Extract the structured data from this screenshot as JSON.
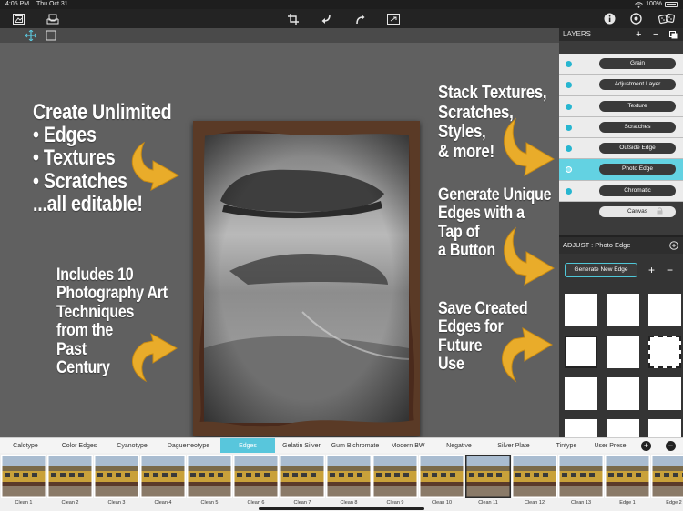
{
  "status": {
    "time": "4:05 PM",
    "date": "Thu Oct 31",
    "battery": "100%"
  },
  "toolbar": {
    "left_icons": [
      "gallery-icon",
      "save-tray-icon"
    ],
    "center_icons": [
      "crop-icon",
      "undo-icon",
      "redo-icon",
      "fit-screen-icon"
    ],
    "right_icons": [
      "info-icon",
      "settings-icon",
      "dice-icon"
    ]
  },
  "promo": {
    "left_top": [
      "Create Unlimited",
      "• Edges",
      "• Textures",
      "• Scratches",
      "...all editable!"
    ],
    "left_bottom": [
      "Includes 10",
      "Photography Art",
      "Techniques",
      "from the",
      "Past",
      "Century"
    ],
    "right_1": [
      "Stack Textures,",
      "Scratches,",
      "Styles,",
      "& more!"
    ],
    "right_2": [
      "Generate Unique",
      "Edges with a",
      "Tap of",
      "a Button"
    ],
    "right_3": [
      "Save Created",
      "Edges for",
      "Future",
      "Use"
    ]
  },
  "layers": {
    "title": "LAYERS",
    "add": "+",
    "remove": "−",
    "items": [
      {
        "label": "Grain",
        "selected": false
      },
      {
        "label": "Adjustment Layer",
        "selected": false
      },
      {
        "label": "Texture",
        "selected": false
      },
      {
        "label": "Scratches",
        "selected": false
      },
      {
        "label": "Outside Edge",
        "selected": false
      },
      {
        "label": "Photo Edge",
        "selected": true
      },
      {
        "label": "Chromatic",
        "selected": false
      }
    ],
    "canvas_label": "Canvas"
  },
  "adjust": {
    "title": "ADJUST : Photo Edge",
    "generate_label": "Generate New Edge",
    "add": "+",
    "remove": "−"
  },
  "tabs": {
    "items": [
      "Calotype",
      "Color Edges",
      "Cyanotype",
      "Daguerreotype",
      "Edges",
      "Gelatin Silver",
      "Gum Bichromate",
      "Modern BW",
      "Negative",
      "Silver Plate",
      "Tintype",
      "User Prese"
    ],
    "active": "Edges",
    "add": "+",
    "remove": "−"
  },
  "thumbnails": [
    "Clean 1",
    "Clean 2",
    "Clean 3",
    "Clean 4",
    "Clean 5",
    "Clean 6",
    "Clean 7",
    "Clean 8",
    "Clean 9",
    "Clean 10",
    "Clean 11",
    "Clean 12",
    "Clean 13",
    "Edge 1",
    "Edge 2"
  ],
  "colors": {
    "accent": "#58c6dc",
    "arrow": "#e9ac2a",
    "selected_layer": "#63d2e2"
  }
}
